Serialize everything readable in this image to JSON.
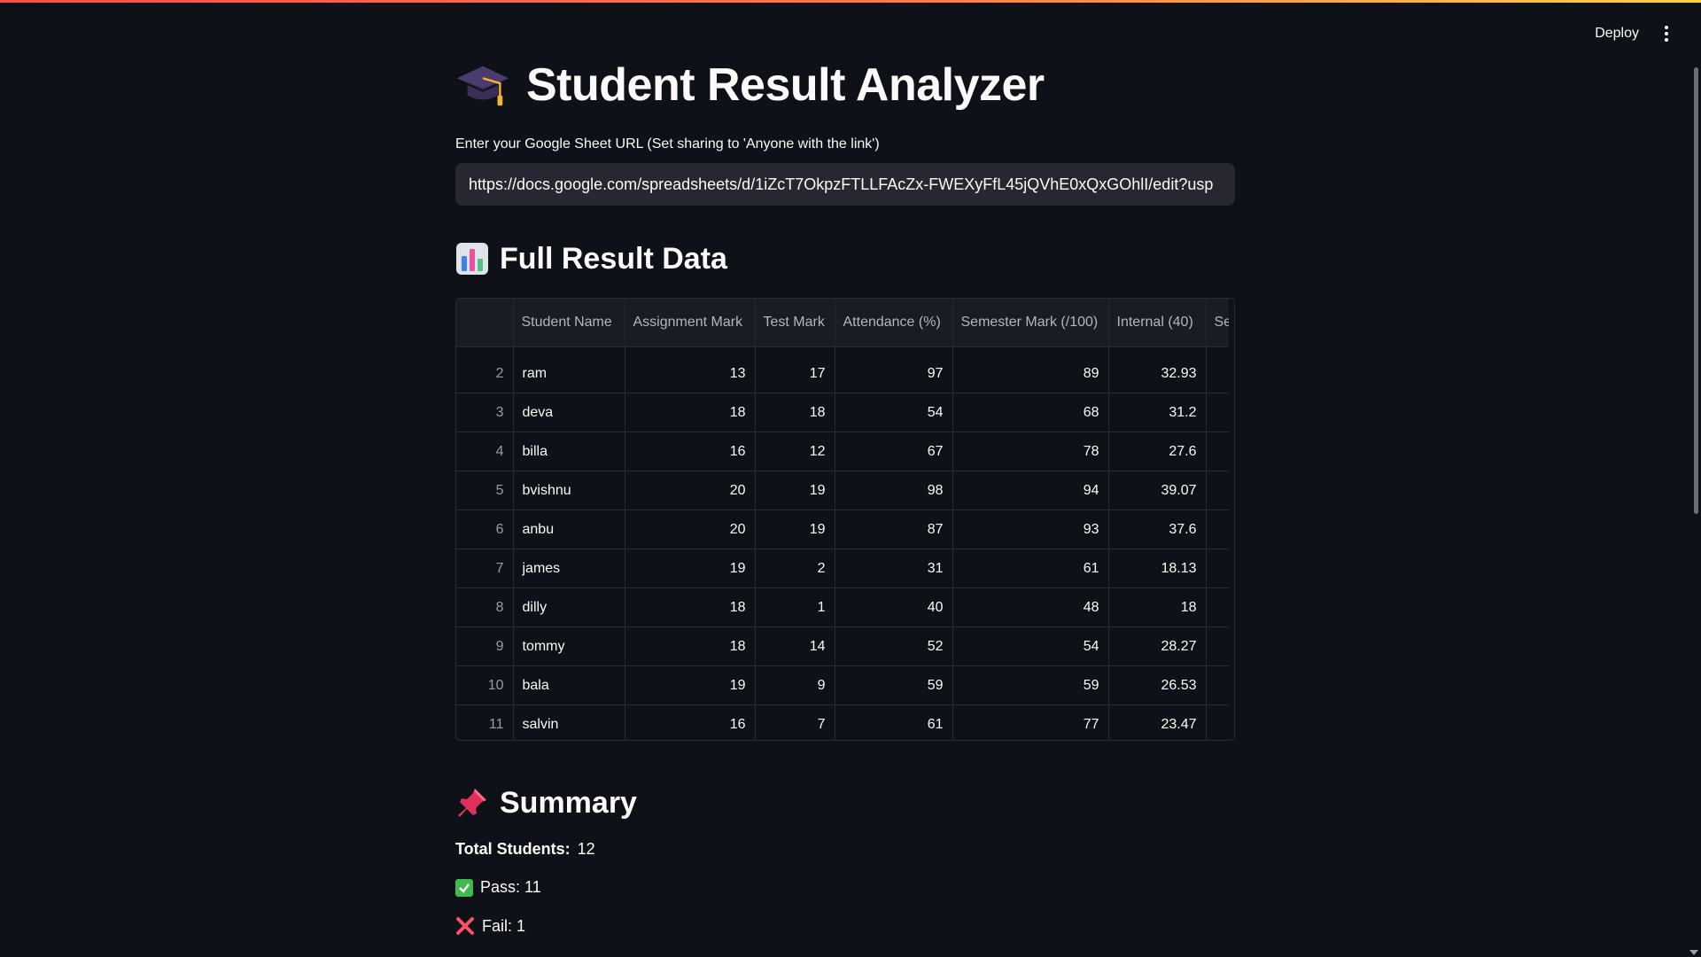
{
  "header": {
    "deploy_label": "Deploy"
  },
  "page": {
    "title": "Student Result Analyzer",
    "url_label": "Enter your Google Sheet URL (Set sharing to 'Anyone with the link')",
    "url_value": "https://docs.google.com/spreadsheets/d/1iZcT7OkpzFTLLFAcZx-FWEXyFfL45jQVhE0xQxGOhlI/edit?usp"
  },
  "data_section": {
    "heading": "Full Result Data",
    "columns": [
      "",
      "Student Name",
      "Assignment Mark",
      "Test Mark",
      "Attendance (%)",
      "Semester Mark (/100)",
      "Internal (40)",
      "Se"
    ],
    "rows": [
      {
        "idx": "2",
        "name": "ram",
        "assignment": "13",
        "test": "17",
        "attendance": "97",
        "semester": "89",
        "internal": "32.93"
      },
      {
        "idx": "3",
        "name": "deva",
        "assignment": "18",
        "test": "18",
        "attendance": "54",
        "semester": "68",
        "internal": "31.2"
      },
      {
        "idx": "4",
        "name": "billa",
        "assignment": "16",
        "test": "12",
        "attendance": "67",
        "semester": "78",
        "internal": "27.6"
      },
      {
        "idx": "5",
        "name": "bvishnu",
        "assignment": "20",
        "test": "19",
        "attendance": "98",
        "semester": "94",
        "internal": "39.07"
      },
      {
        "idx": "6",
        "name": "anbu",
        "assignment": "20",
        "test": "19",
        "attendance": "87",
        "semester": "93",
        "internal": "37.6"
      },
      {
        "idx": "7",
        "name": "james",
        "assignment": "19",
        "test": "2",
        "attendance": "31",
        "semester": "61",
        "internal": "18.13"
      },
      {
        "idx": "8",
        "name": "dilly",
        "assignment": "18",
        "test": "1",
        "attendance": "40",
        "semester": "48",
        "internal": "18"
      },
      {
        "idx": "9",
        "name": "tommy",
        "assignment": "18",
        "test": "14",
        "attendance": "52",
        "semester": "54",
        "internal": "28.27"
      },
      {
        "idx": "10",
        "name": "bala",
        "assignment": "19",
        "test": "9",
        "attendance": "59",
        "semester": "59",
        "internal": "26.53"
      },
      {
        "idx": "11",
        "name": "salvin",
        "assignment": "16",
        "test": "7",
        "attendance": "61",
        "semester": "77",
        "internal": "23.47"
      }
    ]
  },
  "summary": {
    "heading": "Summary",
    "total_label": "Total Students:",
    "total_value": "12",
    "pass_text": "Pass: 11",
    "fail_text": "Fail: 1"
  },
  "icons": {
    "title": "graduation-cap-icon",
    "data": "bar-chart-icon",
    "summary": "pushpin-icon",
    "pass": "check-mark-icon",
    "fail": "cross-mark-icon"
  },
  "colors": {
    "background": "#0e1117",
    "input_bg": "#262730",
    "header_bg": "#1a1c24",
    "pass_green": "#3fb950",
    "fail_red": "#f85169"
  }
}
